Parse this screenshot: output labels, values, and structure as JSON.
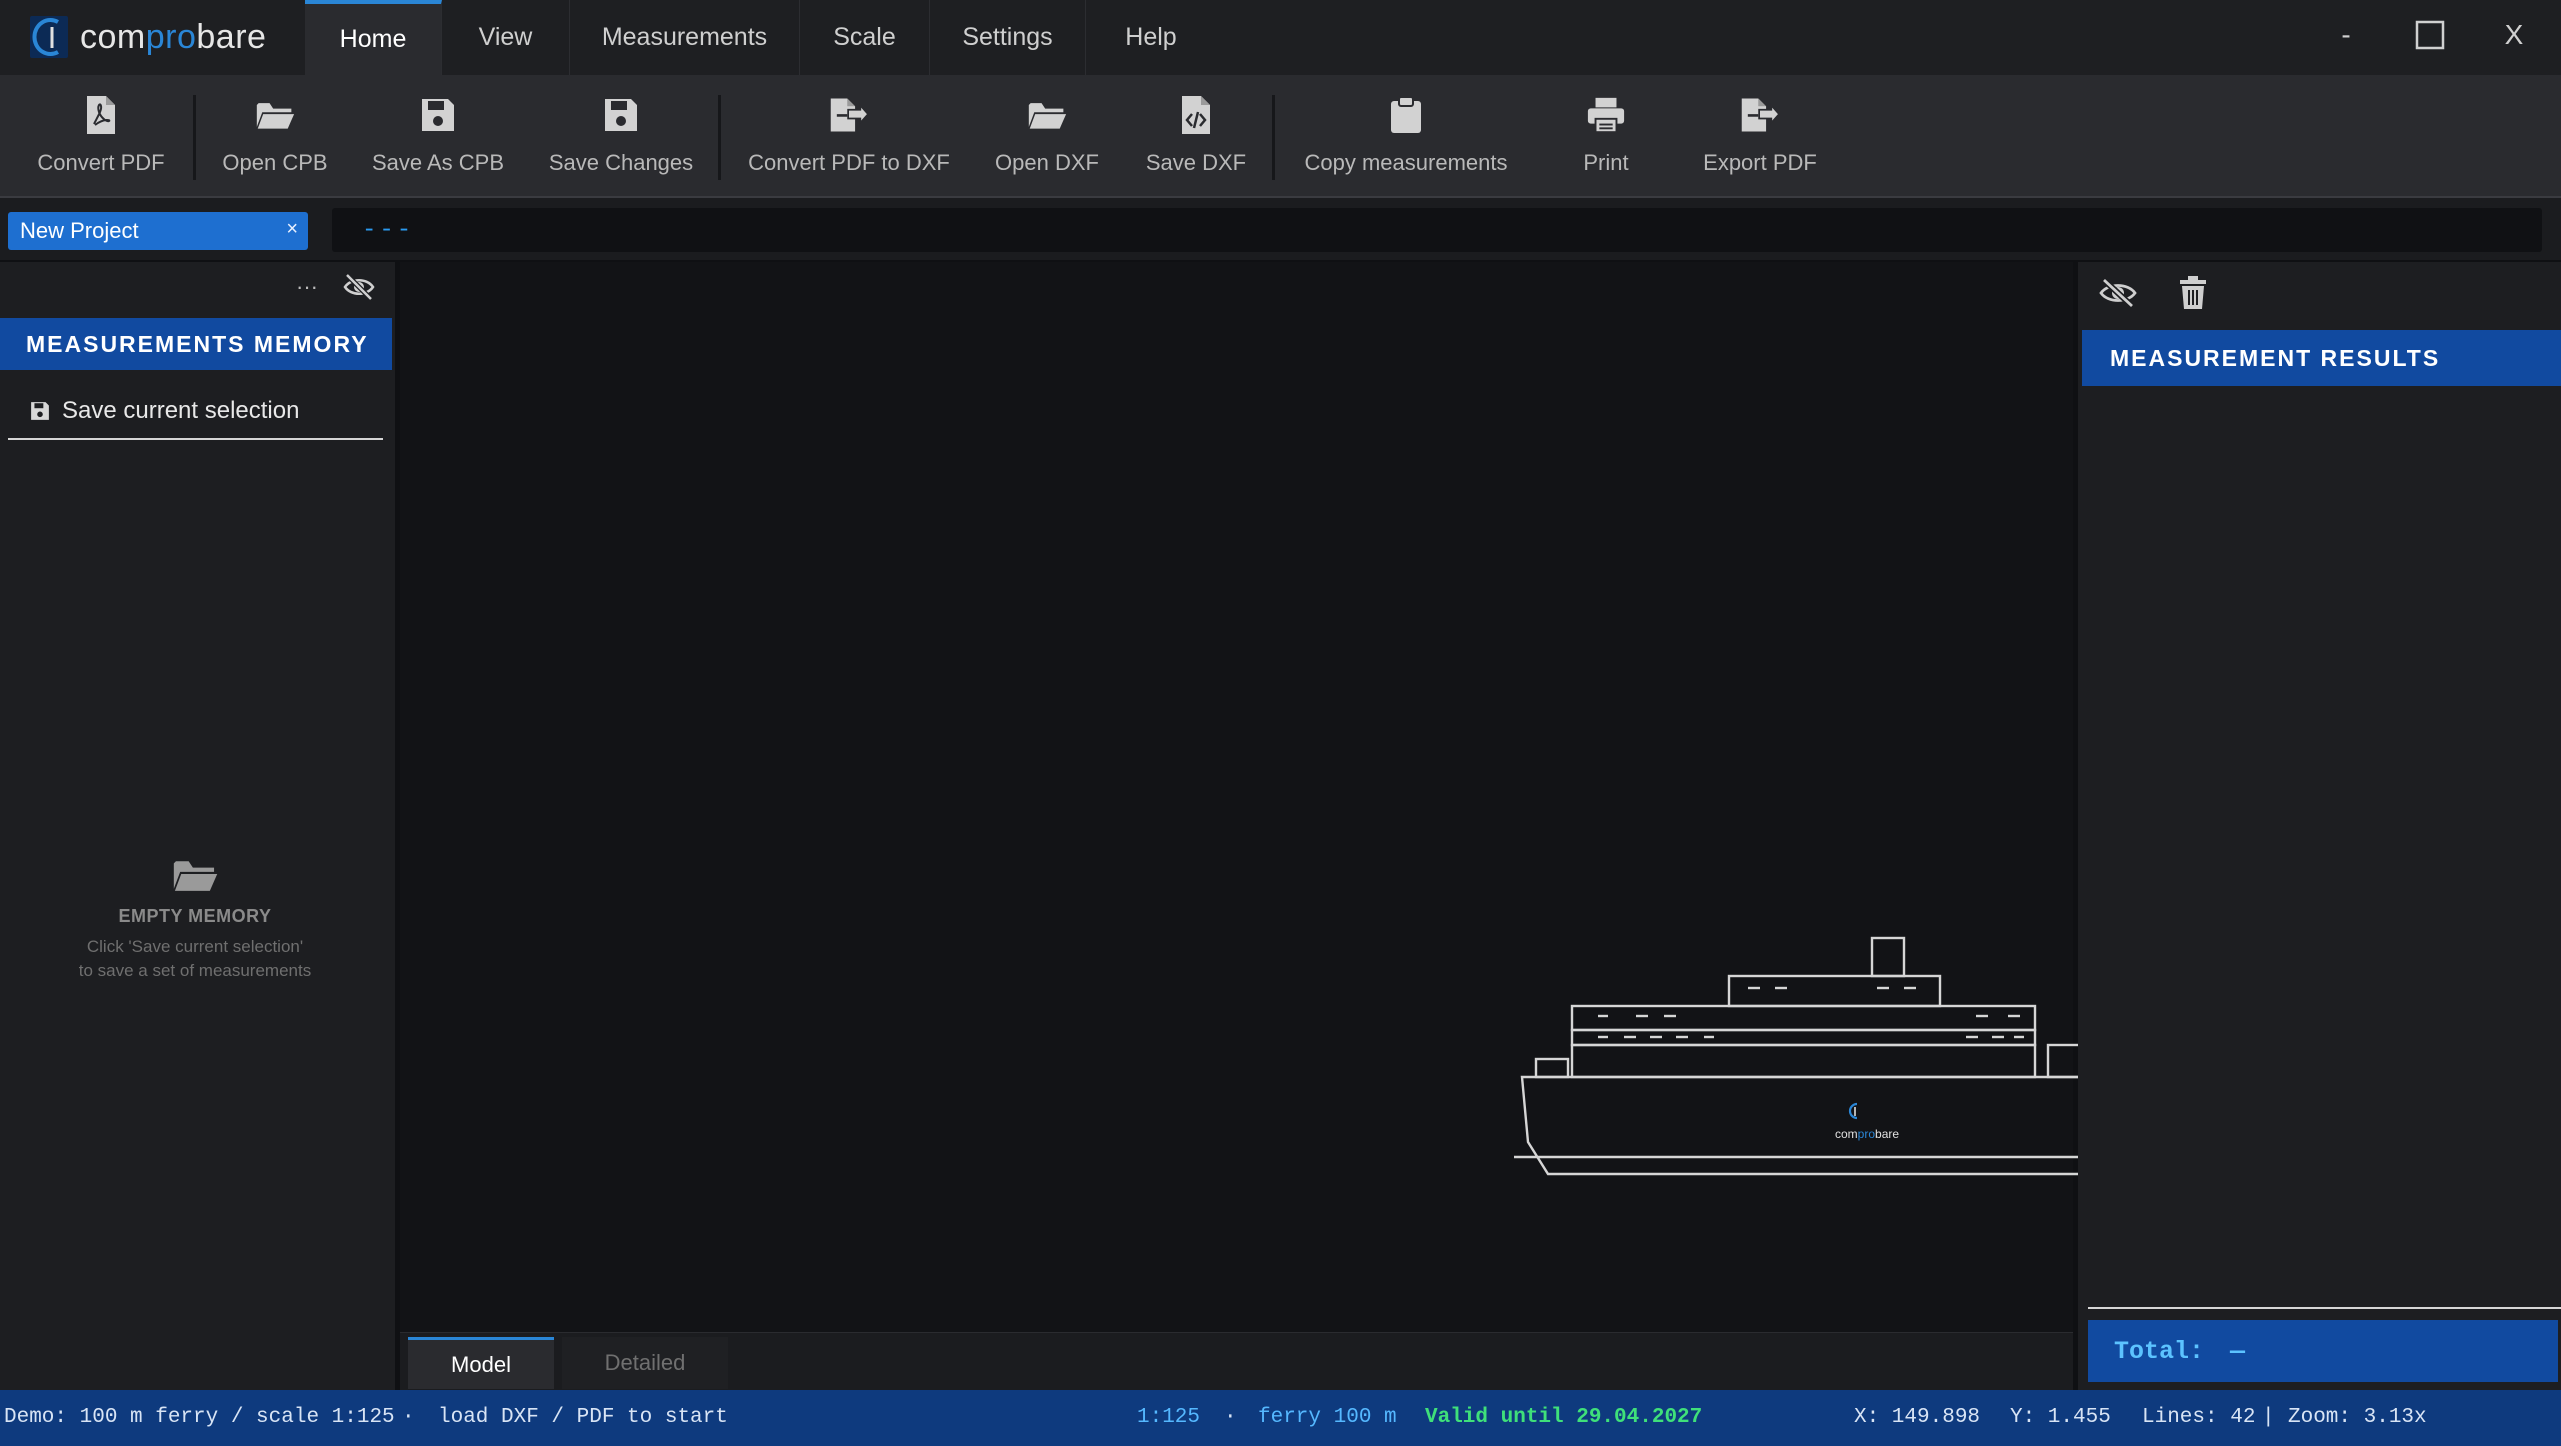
{
  "app": {
    "name_pre": "com",
    "name_mid": "pro",
    "name_post": "bare",
    "accent": "#1e6fd0"
  },
  "menu": {
    "tabs": [
      "Home",
      "View",
      "Measurements",
      "Scale",
      "Settings",
      "Help"
    ],
    "active": "Home",
    "window": {
      "minimize": "-",
      "maximize": "□",
      "close": "X"
    }
  },
  "toolbar": {
    "buttons": [
      {
        "label": "Convert PDF",
        "icon": "pdf-file-icon"
      },
      {
        "label": "Open CPB",
        "icon": "folder-open-icon"
      },
      {
        "label": "Save As CPB",
        "icon": "floppy-disk-icon"
      },
      {
        "label": "Save Changes",
        "icon": "floppy-disk-icon"
      },
      {
        "label": "Convert PDF to DXF",
        "icon": "file-export-icon"
      },
      {
        "label": "Open DXF",
        "icon": "folder-open-icon"
      },
      {
        "label": "Save DXF",
        "icon": "file-code-icon"
      },
      {
        "label": "Copy measurements",
        "icon": "clipboard-icon"
      },
      {
        "label": "Print",
        "icon": "printer-icon"
      },
      {
        "label": "Export PDF",
        "icon": "file-export-icon"
      }
    ]
  },
  "project": {
    "tab_label": "New Project",
    "close": "×",
    "path": "---"
  },
  "left_panel": {
    "more": "···",
    "header": "MEASUREMENTS MEMORY",
    "save_selection": "Save current selection",
    "empty_title": "EMPTY MEMORY",
    "empty_hint_1": "Click 'Save current selection'",
    "empty_hint_2": "to save a set of measurements"
  },
  "canvas": {
    "ship_logo_pre": "com",
    "ship_logo_mid": "pro",
    "ship_logo_post": "bare",
    "view_tabs": [
      "Model",
      "Detailed"
    ],
    "active_view": "Model"
  },
  "right_panel": {
    "header": "MEASUREMENT RESULTS",
    "total_label": "Total:",
    "total_value": "—"
  },
  "status": {
    "demo": "Demo: 100 m ferry / scale 1:125",
    "dot": "·",
    "hint": "load DXF / PDF to start",
    "scale": "1:125",
    "model": "ferry 100 m",
    "license": "Valid until 29.04.2027",
    "x": "X: 149.898",
    "y": "Y: 1.455",
    "lines": "Lines: 42",
    "bar": "|",
    "zoom": "Zoom: 3.13x",
    "colors": {
      "blue": "#55b8ff",
      "green": "#3fe07a"
    }
  }
}
